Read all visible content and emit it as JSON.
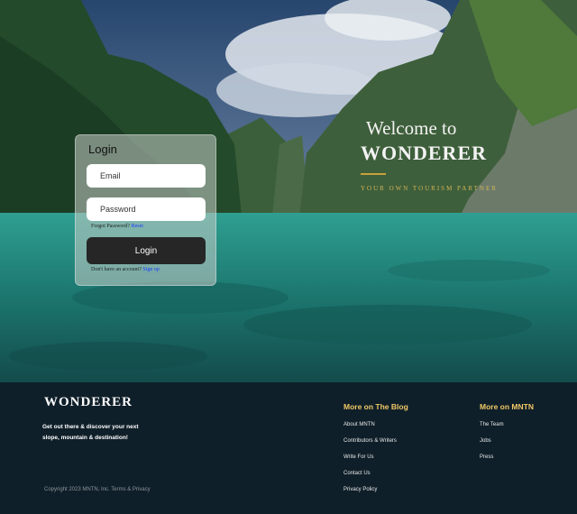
{
  "hero": {
    "welcome_pre": "Welcome to",
    "welcome_brand": "WONDERER",
    "tagline": "YOUR OWN TOURISM PARTNER"
  },
  "login": {
    "title": "Login",
    "email_placeholder": "Email",
    "password_placeholder": "Password",
    "forgot_text": "Forgot Password?",
    "reset_link": "Reset",
    "submit_label": "Login",
    "no_account_text": "Don't have an account?",
    "signup_link": "Sign up"
  },
  "footer": {
    "brand": "WONDERER",
    "tagline": "Get out there & discover your next slope, mountain & destination!",
    "copyright": "Copyright 2023 MNTN, Inc. Terms & Privacy",
    "blog_heading": "More on The Blog",
    "blog_links": [
      "About MNTN",
      "Contributors & Writers",
      "Write For Us",
      "Contact Us",
      "Privacy Policy"
    ],
    "mntn_heading": "More on MNTN",
    "mntn_links": [
      "The Team",
      "Jobs",
      "Press"
    ]
  },
  "colors": {
    "footer_bg": "#0f1f29",
    "accent_gold": "#f1c866",
    "water": "#1e7c74"
  }
}
